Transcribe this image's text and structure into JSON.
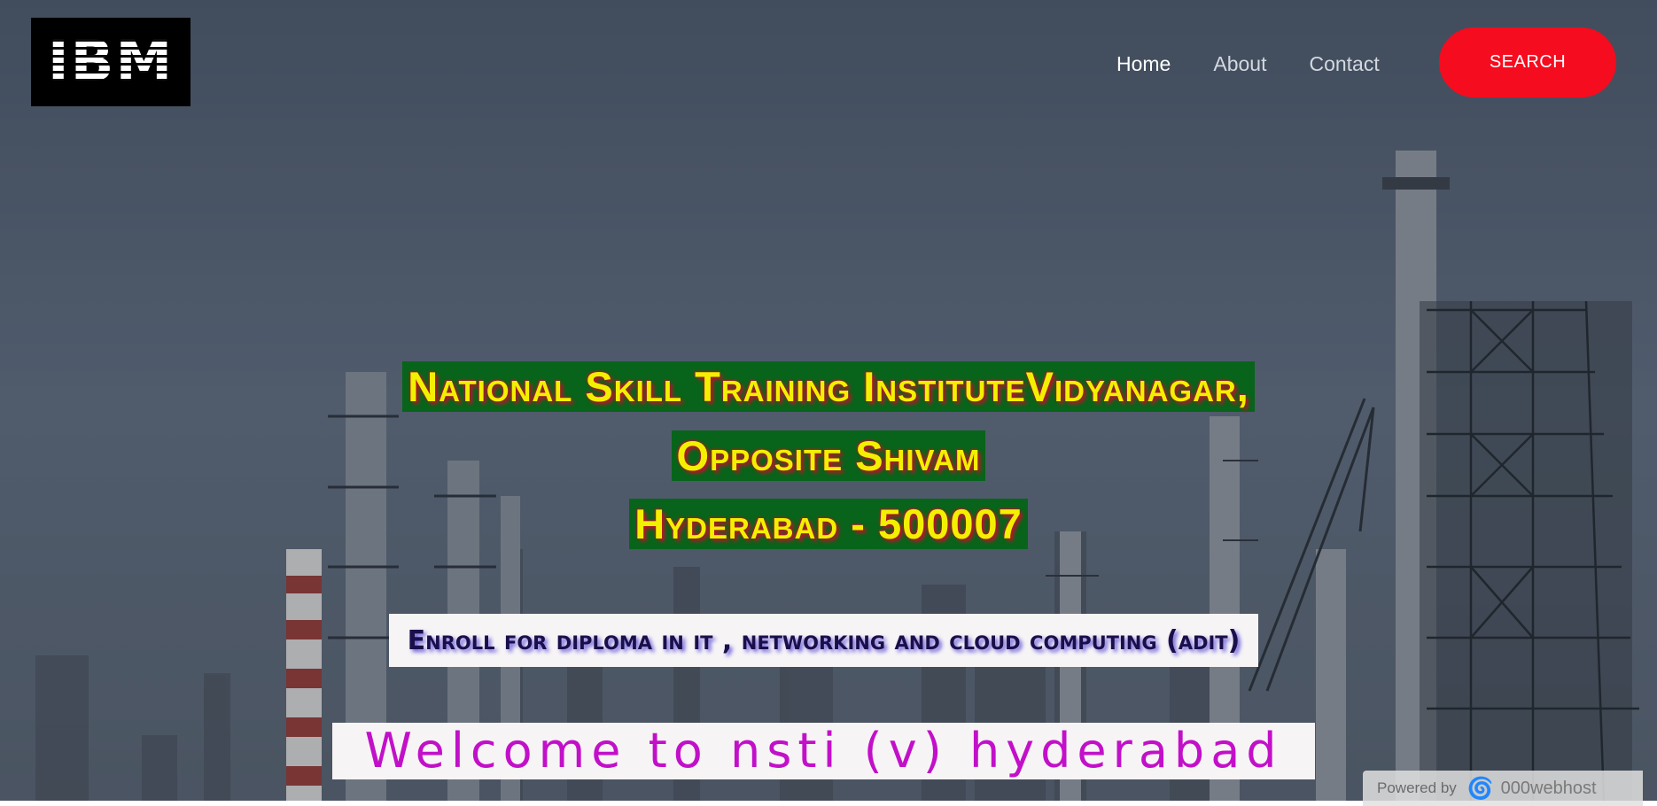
{
  "header": {
    "logo_text": "IBM",
    "nav": [
      {
        "label": "Home",
        "active": true
      },
      {
        "label": "About",
        "active": false
      },
      {
        "label": "Contact",
        "active": false
      }
    ],
    "search_label": "SEARCH"
  },
  "hero": {
    "heading_line1": "National Skill Training InstituteVidyanagar,",
    "heading_line2": "Opposite Shivam",
    "heading_line3": "Hyderabad - 500007",
    "enroll_text": "Enroll for diploma in it , networking and cloud computing (adit)",
    "welcome_text": "Welcome to nsti (v) hyderabad"
  },
  "footer_badge": {
    "powered_label": "Powered by",
    "brand": "000webhost"
  },
  "colors": {
    "search_button": "#f50c1e",
    "heading_text": "#f2f000",
    "heading_bg": "#08641a",
    "welcome_text": "#c210c9",
    "enroll_text": "#1b0f4b"
  },
  "icons": {
    "host_logo": "000webhost-swirl-icon"
  }
}
